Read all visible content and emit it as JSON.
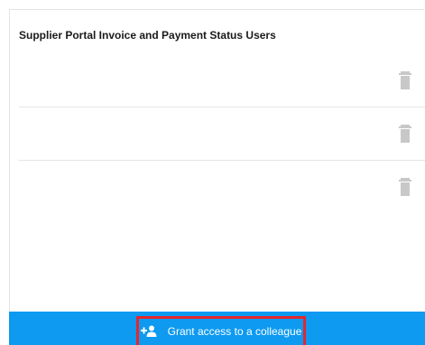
{
  "panel": {
    "title": "Supplier Portal Invoice and Payment Status Users"
  },
  "users": [
    {
      "delete_icon": "trash-icon"
    },
    {
      "delete_icon": "trash-icon"
    },
    {
      "delete_icon": "trash-icon"
    }
  ],
  "footer": {
    "grant_label": "Grant access to a colleague",
    "grant_icon": "add-user-icon",
    "background_color": "#0d9af0",
    "highlight_color": "#e4262c"
  }
}
